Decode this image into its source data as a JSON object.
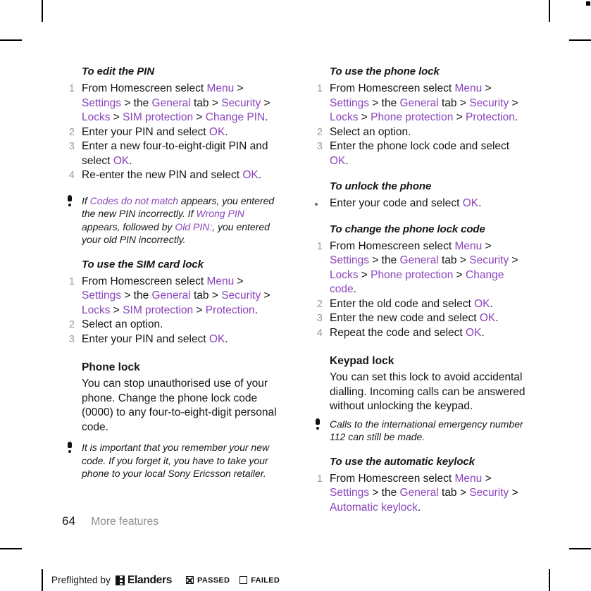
{
  "document": {
    "folio": "64",
    "running_head": "More features"
  },
  "colors": {
    "link": "#8b45bd",
    "step_number": "#9a9a9a",
    "running_head": "#8d8d8d",
    "body_text": "#161616"
  },
  "left_column": {
    "proc_edit_pin": {
      "title": "To edit the PIN",
      "steps": [
        {
          "num": "1",
          "parts": [
            {
              "t": "From Homescreen select ",
              "link": false
            },
            {
              "t": "Menu",
              "link": true
            },
            {
              "t": " > ",
              "link": false
            },
            {
              "t": "Settings",
              "link": true
            },
            {
              "t": " > the ",
              "link": false
            },
            {
              "t": "General",
              "link": true
            },
            {
              "t": " tab > ",
              "link": false
            },
            {
              "t": "Security",
              "link": true
            },
            {
              "t": " > ",
              "link": false
            },
            {
              "t": "Locks",
              "link": true
            },
            {
              "t": " > ",
              "link": false
            },
            {
              "t": "SIM protection",
              "link": true
            },
            {
              "t": " > ",
              "link": false
            },
            {
              "t": "Change PIN",
              "link": true
            },
            {
              "t": ".",
              "link": false
            }
          ]
        },
        {
          "num": "2",
          "parts": [
            {
              "t": "Enter your PIN and select ",
              "link": false
            },
            {
              "t": "OK",
              "link": true
            },
            {
              "t": ".",
              "link": false
            }
          ]
        },
        {
          "num": "3",
          "parts": [
            {
              "t": "Enter a new four-to-eight-digit PIN and select ",
              "link": false
            },
            {
              "t": "OK",
              "link": true
            },
            {
              "t": ".",
              "link": false
            }
          ]
        },
        {
          "num": "4",
          "parts": [
            {
              "t": "Re-enter the new PIN and select ",
              "link": false
            },
            {
              "t": "OK",
              "link": true
            },
            {
              "t": ".",
              "link": false
            }
          ]
        }
      ]
    },
    "note_codes": {
      "icon": "exclamation-icon",
      "parts": [
        {
          "t": "If ",
          "link": false
        },
        {
          "t": "Codes do not match",
          "link": true
        },
        {
          "t": " appears, you entered the new PIN incorrectly. If ",
          "link": false
        },
        {
          "t": "Wrong PIN",
          "link": true
        },
        {
          "t": " appears, followed by ",
          "link": false
        },
        {
          "t": "Old PIN:",
          "link": true
        },
        {
          "t": ", you entered your old PIN incorrectly.",
          "link": false
        }
      ]
    },
    "proc_sim_card_lock": {
      "title": "To use the SIM card lock",
      "steps": [
        {
          "num": "1",
          "parts": [
            {
              "t": "From Homescreen select ",
              "link": false
            },
            {
              "t": "Menu",
              "link": true
            },
            {
              "t": " > ",
              "link": false
            },
            {
              "t": "Settings",
              "link": true
            },
            {
              "t": " > the ",
              "link": false
            },
            {
              "t": "General",
              "link": true
            },
            {
              "t": " tab > ",
              "link": false
            },
            {
              "t": "Security",
              "link": true
            },
            {
              "t": " > ",
              "link": false
            },
            {
              "t": "Locks",
              "link": true
            },
            {
              "t": " > ",
              "link": false
            },
            {
              "t": "SIM protection",
              "link": true
            },
            {
              "t": " > ",
              "link": false
            },
            {
              "t": "Protection",
              "link": true
            },
            {
              "t": ".",
              "link": false
            }
          ]
        },
        {
          "num": "2",
          "parts": [
            {
              "t": "Select an option.",
              "link": false
            }
          ]
        },
        {
          "num": "3",
          "parts": [
            {
              "t": "Enter your PIN and select ",
              "link": false
            },
            {
              "t": "OK",
              "link": true
            },
            {
              "t": ".",
              "link": false
            }
          ]
        }
      ]
    },
    "section_phone_lock": {
      "title": "Phone lock",
      "body": "You can stop unauthorised use of your phone. Change the phone lock code (0000) to any four-to-eight-digit personal code."
    },
    "note_remember": {
      "icon": "exclamation-icon",
      "parts": [
        {
          "t": "It is important that you remember your new code. If you forget it, you have to take your phone to your local Sony Ericsson retailer.",
          "link": false
        }
      ]
    }
  },
  "right_column": {
    "proc_use_phone_lock": {
      "title": "To use the phone lock",
      "steps": [
        {
          "num": "1",
          "parts": [
            {
              "t": "From Homescreen select ",
              "link": false
            },
            {
              "t": "Menu",
              "link": true
            },
            {
              "t": " > ",
              "link": false
            },
            {
              "t": "Settings",
              "link": true
            },
            {
              "t": " > the ",
              "link": false
            },
            {
              "t": "General",
              "link": true
            },
            {
              "t": " tab > ",
              "link": false
            },
            {
              "t": "Security",
              "link": true
            },
            {
              "t": " > ",
              "link": false
            },
            {
              "t": "Locks",
              "link": true
            },
            {
              "t": " > ",
              "link": false
            },
            {
              "t": "Phone protection",
              "link": true
            },
            {
              "t": " > ",
              "link": false
            },
            {
              "t": "Protection",
              "link": true
            },
            {
              "t": ".",
              "link": false
            }
          ]
        },
        {
          "num": "2",
          "parts": [
            {
              "t": "Select an option.",
              "link": false
            }
          ]
        },
        {
          "num": "3",
          "parts": [
            {
              "t": "Enter the phone lock code and select ",
              "link": false
            },
            {
              "t": "OK",
              "link": true
            },
            {
              "t": ".",
              "link": false
            }
          ]
        }
      ]
    },
    "proc_unlock_phone": {
      "title": "To unlock the phone",
      "bullets": [
        {
          "parts": [
            {
              "t": "Enter your code and select ",
              "link": false
            },
            {
              "t": "OK",
              "link": true
            },
            {
              "t": ".",
              "link": false
            }
          ]
        }
      ]
    },
    "proc_change_lock_code": {
      "title": "To change the phone lock code",
      "steps": [
        {
          "num": "1",
          "parts": [
            {
              "t": "From Homescreen select ",
              "link": false
            },
            {
              "t": "Menu",
              "link": true
            },
            {
              "t": " > ",
              "link": false
            },
            {
              "t": "Settings",
              "link": true
            },
            {
              "t": " > the ",
              "link": false
            },
            {
              "t": "General",
              "link": true
            },
            {
              "t": " tab > ",
              "link": false
            },
            {
              "t": "Security",
              "link": true
            },
            {
              "t": " > ",
              "link": false
            },
            {
              "t": "Locks",
              "link": true
            },
            {
              "t": " > ",
              "link": false
            },
            {
              "t": "Phone protection",
              "link": true
            },
            {
              "t": " > ",
              "link": false
            },
            {
              "t": "Change code",
              "link": true
            },
            {
              "t": ".",
              "link": false
            }
          ]
        },
        {
          "num": "2",
          "parts": [
            {
              "t": "Enter the old code and select ",
              "link": false
            },
            {
              "t": "OK",
              "link": true
            },
            {
              "t": ".",
              "link": false
            }
          ]
        },
        {
          "num": "3",
          "parts": [
            {
              "t": "Enter the new code and select ",
              "link": false
            },
            {
              "t": "OK",
              "link": true
            },
            {
              "t": ".",
              "link": false
            }
          ]
        },
        {
          "num": "4",
          "parts": [
            {
              "t": "Repeat the code and select ",
              "link": false
            },
            {
              "t": "OK",
              "link": true
            },
            {
              "t": ".",
              "link": false
            }
          ]
        }
      ]
    },
    "section_keypad_lock": {
      "title": "Keypad lock",
      "body": "You can set this lock to avoid accidental dialling. Incoming calls can be answered without unlocking the keypad."
    },
    "note_emergency": {
      "icon": "exclamation-icon",
      "parts": [
        {
          "t": "Calls to the international emergency number 112 can still be made.",
          "link": false
        }
      ]
    },
    "proc_automatic_keylock": {
      "title": "To use the automatic keylock",
      "steps": [
        {
          "num": "1",
          "parts": [
            {
              "t": "From Homescreen select ",
              "link": false
            },
            {
              "t": "Menu",
              "link": true
            },
            {
              "t": " > ",
              "link": false
            },
            {
              "t": "Settings",
              "link": true
            },
            {
              "t": " > the ",
              "link": false
            },
            {
              "t": "General",
              "link": true
            },
            {
              "t": " tab > ",
              "link": false
            },
            {
              "t": "Security",
              "link": true
            },
            {
              "t": " > ",
              "link": false
            },
            {
              "t": "Automatic keylock",
              "link": true
            },
            {
              "t": ".",
              "link": false
            }
          ]
        }
      ]
    }
  },
  "preflight": {
    "text": "Preflighted by",
    "brand": "Elanders",
    "passed_label": "PASSED",
    "failed_label": "FAILED",
    "passed_checked": true,
    "failed_checked": false
  }
}
